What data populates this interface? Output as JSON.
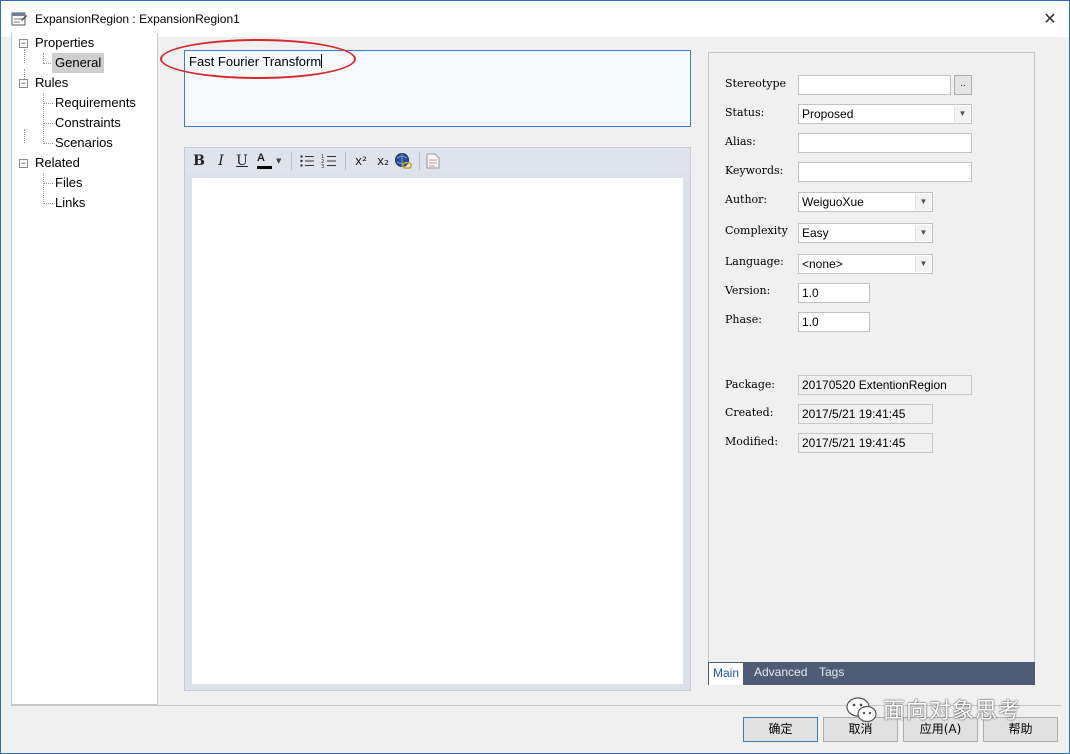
{
  "window": {
    "title": "ExpansionRegion : ExpansionRegion1"
  },
  "tree": {
    "items": [
      {
        "label": "Properties",
        "expander": "⊟"
      },
      {
        "label": "General"
      },
      {
        "label": "Rules",
        "expander": "⊟"
      },
      {
        "label": "Requirements"
      },
      {
        "label": "Constraints"
      },
      {
        "label": "Scenarios"
      },
      {
        "label": "Related",
        "expander": "⊟"
      },
      {
        "label": "Files"
      },
      {
        "label": "Links"
      }
    ],
    "selected": "General"
  },
  "name": {
    "value": "Fast Fourier Transform"
  },
  "toolbar": {
    "bold": "B",
    "italic": "I",
    "underline": "U",
    "font_color": "A",
    "superscript": "x²",
    "subscript": "x₂"
  },
  "props": {
    "stereotype": {
      "label": "Stereotype",
      "value": "",
      "button": ".."
    },
    "status": {
      "label": "Status:",
      "value": "Proposed"
    },
    "alias": {
      "label": "Alias:",
      "value": ""
    },
    "keywords": {
      "label": "Keywords:",
      "value": ""
    },
    "author": {
      "label": "Author:",
      "value": "WeiguoXue"
    },
    "complexity": {
      "label": "Complexity",
      "value": "Easy"
    },
    "language": {
      "label": "Language:",
      "value": "<none>"
    },
    "version": {
      "label": "Version:",
      "value": "1.0"
    },
    "phase": {
      "label": "Phase:",
      "value": "1.0"
    },
    "package": {
      "label": "Package:",
      "value": "20170520 ExtentionRegion"
    },
    "created": {
      "label": "Created:",
      "value": "2017/5/21 19:41:45"
    },
    "modified": {
      "label": "Modified:",
      "value": "2017/5/21 19:41:45"
    }
  },
  "tabs": [
    {
      "label": "Main"
    },
    {
      "label": "Advanced"
    },
    {
      "label": "Tags"
    }
  ],
  "buttons": {
    "ok": "确定",
    "cancel": "取消",
    "apply": "应用(A)",
    "help": "帮助"
  },
  "watermark": {
    "text": "面向对象思考"
  },
  "colors": {
    "accent": "#3d7bd0",
    "tab_bar": "#4d5b75",
    "highlight": "#d42a2a"
  }
}
